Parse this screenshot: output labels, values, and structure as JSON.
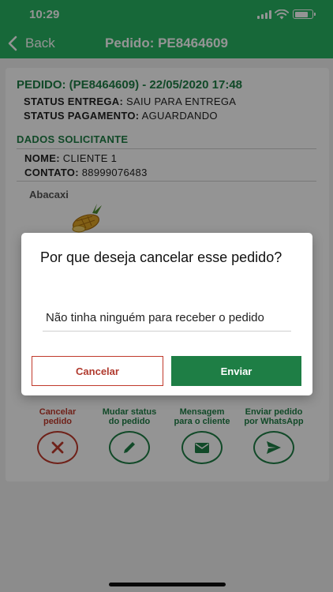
{
  "status_bar": {
    "time": "10:29"
  },
  "nav": {
    "back_label": "Back",
    "title": "Pedido: PE8464609"
  },
  "order": {
    "title": "PEDIDO: (PE8464609) - 22/05/2020 17:48",
    "status_entrega_label": "STATUS ENTREGA:",
    "status_entrega_value": "SAIU PARA ENTREGA",
    "status_pagamento_label": "STATUS PAGAMENTO:",
    "status_pagamento_value": "AGUARDANDO"
  },
  "solicitante": {
    "section_title": "DADOS SOLICITANTE",
    "nome_label": "NOME:",
    "nome_value": "CLIENTE 1",
    "contato_label": "CONTATO:",
    "contato_value": "88999076483"
  },
  "product": {
    "name": "Abacaxi",
    "icon": "pineapple-icon"
  },
  "actions": [
    {
      "label": "Cancelar\npedido",
      "icon": "x-icon",
      "color": "#c0392b"
    },
    {
      "label": "Mudar status\ndo pedido",
      "icon": "pencil-icon",
      "color": "#1e7e45"
    },
    {
      "label": "Mensagem\npara o cliente",
      "icon": "envelope-icon",
      "color": "#1e7e45"
    },
    {
      "label": "Enviar pedido\npor WhatsApp",
      "icon": "send-icon",
      "color": "#1e7e45"
    }
  ],
  "dialog": {
    "title": "Por que deseja cancelar esse pedido?",
    "input_value": "Não tinha ninguém para receber o pedido",
    "cancel_label": "Cancelar",
    "send_label": "Enviar"
  },
  "colors": {
    "brand_green": "#28b463",
    "dark_green": "#1e7e45",
    "danger_red": "#c0392b"
  }
}
